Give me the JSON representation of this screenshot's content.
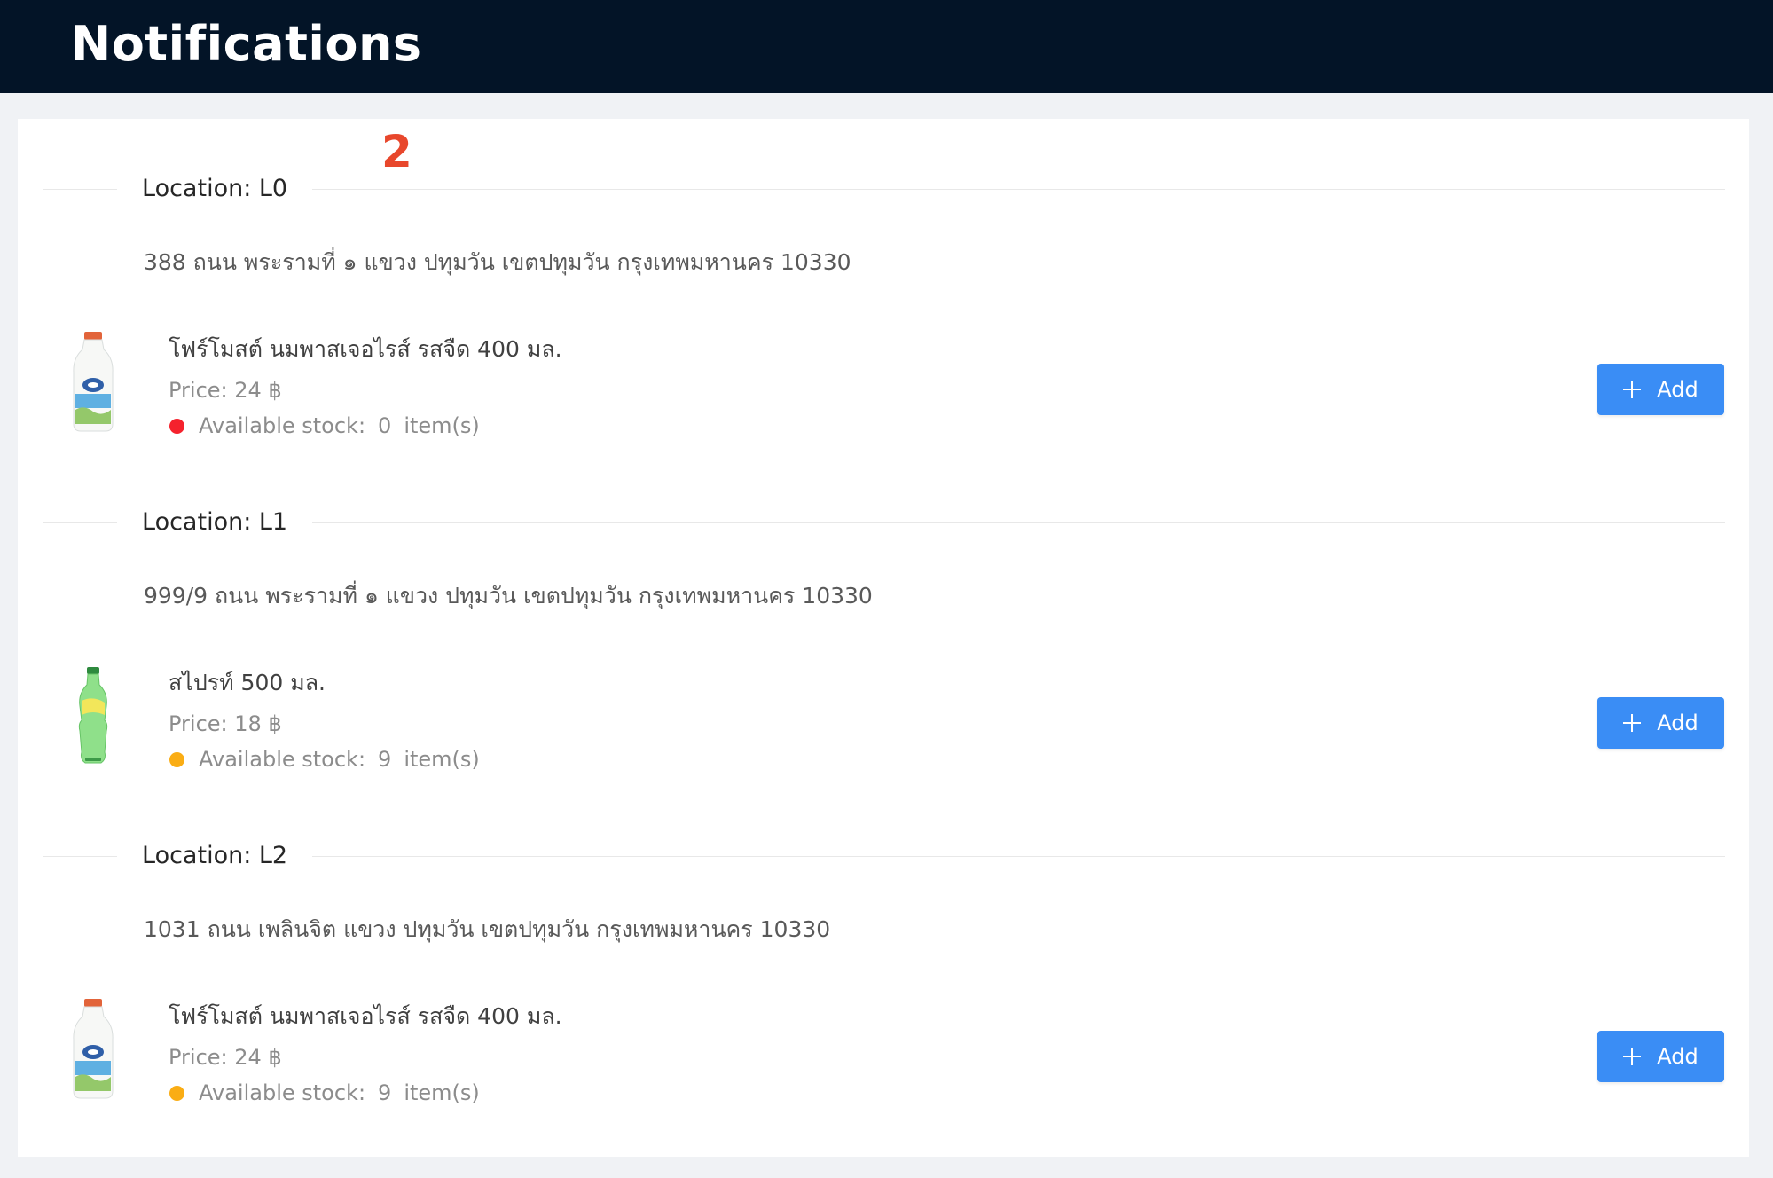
{
  "header": {
    "title": "Notifications"
  },
  "badge_number": "2",
  "locations": [
    {
      "title": "Location: L0",
      "address": "388 ถนน พระรามที่ ๑ แขวง ปทุมวัน เขตปทุมวัน กรุงเทพมหานคร 10330",
      "product": {
        "name": "โฟร์โมสต์ นมพาสเจอไรส์ รสจืด 400 มล.",
        "price": "Price: 24 ฿",
        "stock_label": "Available stock:",
        "stock_count": "0",
        "stock_unit": "item(s)",
        "status_color": "#f5222d",
        "image": "milk-bottle"
      },
      "add_label": "Add"
    },
    {
      "title": "Location: L1",
      "address": "999/9 ถนน พระรามที่ ๑ แขวง ปทุมวัน เขตปทุมวัน กรุงเทพมหานคร 10330",
      "product": {
        "name": "สไปรท์ 500 มล.",
        "price": "Price: 18 ฿",
        "stock_label": "Available stock:",
        "stock_count": "9",
        "stock_unit": "item(s)",
        "status_color": "#faad14",
        "image": "soda-bottle"
      },
      "add_label": "Add"
    },
    {
      "title": "Location: L2",
      "address": "1031 ถนน เพลินจิต แขวง ปทุมวัน เขตปทุมวัน กรุงเทพมหานคร 10330",
      "product": {
        "name": "โฟร์โมสต์ นมพาสเจอไรส์ รสจืด 400 มล.",
        "price": "Price: 24 ฿",
        "stock_label": "Available stock:",
        "stock_count": "9",
        "stock_unit": "item(s)",
        "status_color": "#faad14",
        "image": "milk-bottle"
      },
      "add_label": "Add"
    }
  ],
  "colors": {
    "header_bg": "#031427",
    "accent": "#3a8df5",
    "badge": "#e8472c",
    "out_of_stock": "#f5222d",
    "low_stock": "#faad14"
  }
}
